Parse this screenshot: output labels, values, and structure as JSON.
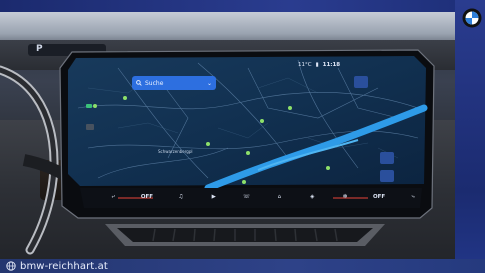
{
  "watermark": {
    "text": "bmw-reichhart.at"
  },
  "cluster": {
    "gear": "P"
  },
  "navigation": {
    "search_label": "Suche",
    "city_label": "Schwarzenbergpl"
  },
  "status": {
    "temperature": "11°C",
    "time": "11:18"
  },
  "climate": {
    "left_value": "OFF",
    "right_value": "OFF"
  },
  "colors": {
    "frame": "#2a3c8f",
    "search": "#2d6fe0",
    "river": "#2e9be8",
    "map_bg": "#0f2a45"
  },
  "icons": [
    "globe-icon",
    "bmw-logo-icon",
    "search-icon",
    "chevron-down-icon",
    "music-icon",
    "phone-icon",
    "home-icon",
    "car-icon",
    "fan-icon",
    "seat-icon"
  ]
}
